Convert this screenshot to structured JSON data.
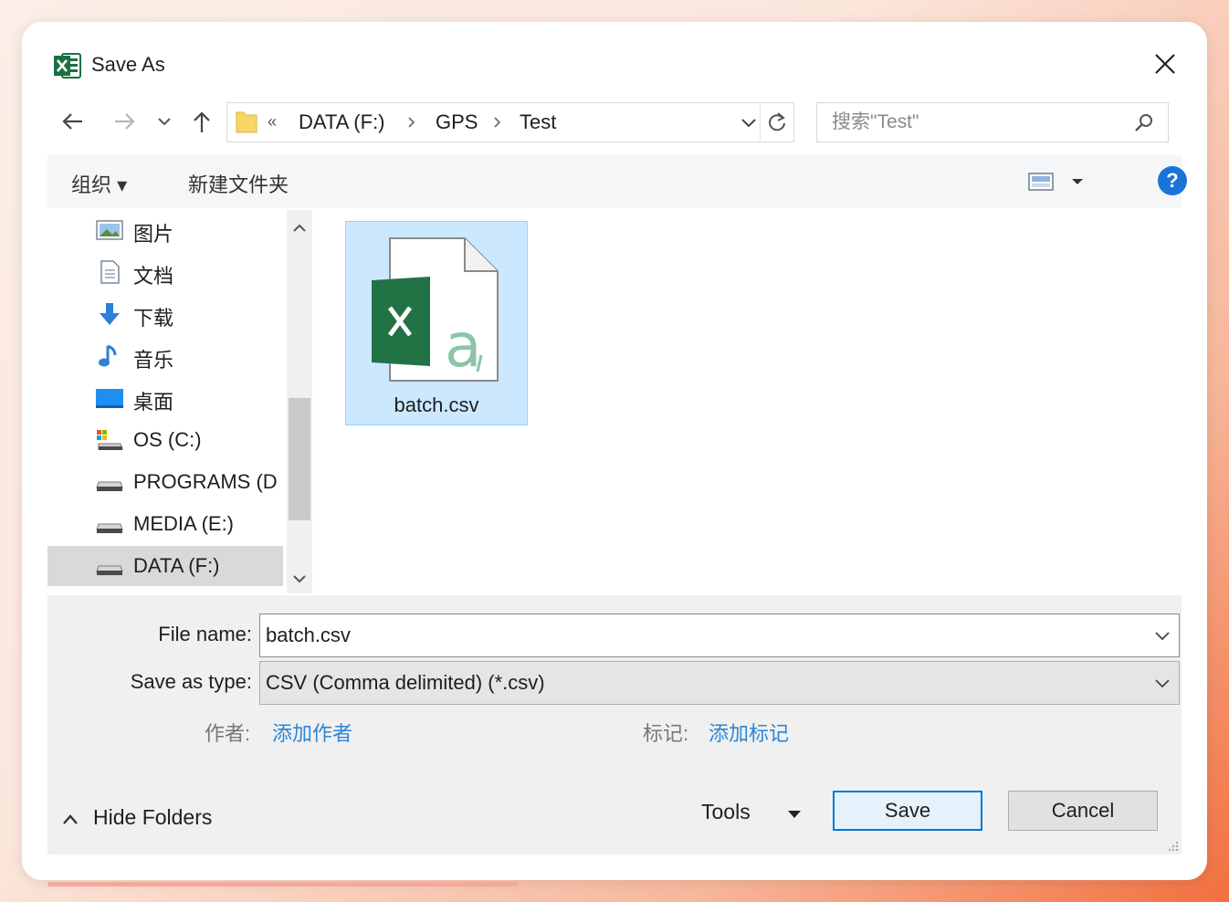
{
  "window": {
    "title": "Save As"
  },
  "navigation": {
    "path": [
      {
        "label": "DATA (F:)"
      },
      {
        "label": "GPS"
      },
      {
        "label": "Test"
      }
    ],
    "overflow_label": "«",
    "search_placeholder": "搜索\"Test\""
  },
  "toolbar": {
    "organize_label": "组织 ▾",
    "new_folder_label": "新建文件夹",
    "help_label": "?"
  },
  "sidebar": {
    "items": [
      {
        "label": "图片",
        "icon": "pictures-icon"
      },
      {
        "label": "文档",
        "icon": "documents-icon"
      },
      {
        "label": "下载",
        "icon": "downloads-icon"
      },
      {
        "label": "音乐",
        "icon": "music-icon"
      },
      {
        "label": "桌面",
        "icon": "desktop-icon"
      },
      {
        "label": "OS (C:)",
        "icon": "system-drive-icon"
      },
      {
        "label": "PROGRAMS (D",
        "icon": "drive-icon"
      },
      {
        "label": "MEDIA (E:)",
        "icon": "drive-icon"
      },
      {
        "label": "DATA (F:)",
        "icon": "drive-icon",
        "selected": true
      }
    ]
  },
  "files": [
    {
      "name": "batch.csv",
      "icon": "excel-csv-file-icon",
      "selected": true
    }
  ],
  "form": {
    "file_name_label": "File name:",
    "file_name_value": "batch.csv",
    "save_type_label": "Save as type:",
    "save_type_value": "CSV (Comma delimited) (*.csv)",
    "author_label": "作者:",
    "author_link": "添加作者",
    "tags_label": "标记:",
    "tags_link": "添加标记"
  },
  "footer": {
    "hide_folders_label": "Hide Folders",
    "tools_label": "Tools",
    "save_label": "Save",
    "cancel_label": "Cancel"
  },
  "colors": {
    "accent": "#0078d7",
    "selection": "#cce8ff",
    "link": "#2b86d6",
    "excel_green": "#1d6f42"
  }
}
